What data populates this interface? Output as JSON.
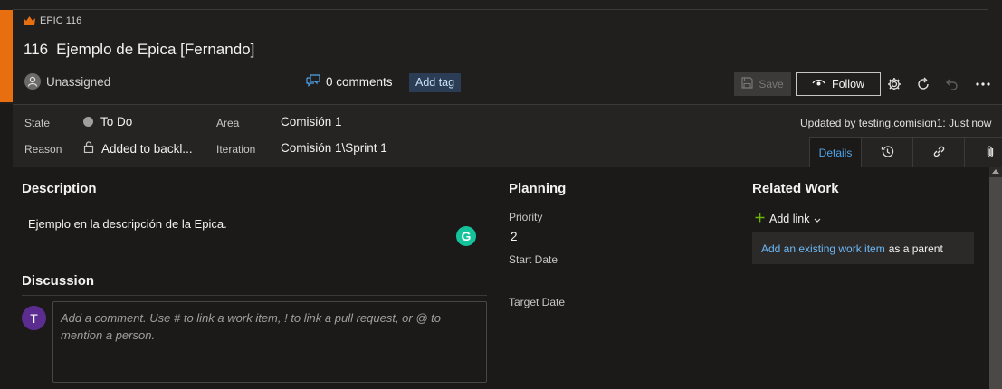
{
  "header": {
    "work_item_type": "EPIC 116",
    "id": "116",
    "title": "Ejemplo de Epica [Fernando]",
    "assignee": "Unassigned",
    "comments": "0 comments",
    "add_tag": "Add tag",
    "save_label": "Save",
    "follow_label": "Follow",
    "accent_color": "#e76f10"
  },
  "fields": {
    "state_label": "State",
    "state_value": "To Do",
    "reason_label": "Reason",
    "reason_value": "Added to backl...",
    "area_label": "Area",
    "area_value": "Comisión 1",
    "iteration_label": "Iteration",
    "iteration_value": "Comisión 1\\Sprint 1",
    "updated": "Updated by testing.comision1: Just now"
  },
  "tabs": {
    "details": "Details",
    "icons": [
      "history-icon",
      "link-icon",
      "attachment-icon"
    ]
  },
  "description": {
    "title": "Description",
    "text": "Ejemplo en la descripción de la Epica."
  },
  "discussion": {
    "title": "Discussion",
    "avatar_initial": "T",
    "placeholder": "Add a comment. Use # to link a work item, ! to link a pull request, or @ to mention a person."
  },
  "planning": {
    "title": "Planning",
    "priority_label": "Priority",
    "priority_value": "2",
    "start_date_label": "Start Date",
    "target_date_label": "Target Date"
  },
  "related": {
    "title": "Related Work",
    "add_link": "Add link",
    "existing_link": "Add an existing work item",
    "existing_suffix": "as a parent"
  }
}
